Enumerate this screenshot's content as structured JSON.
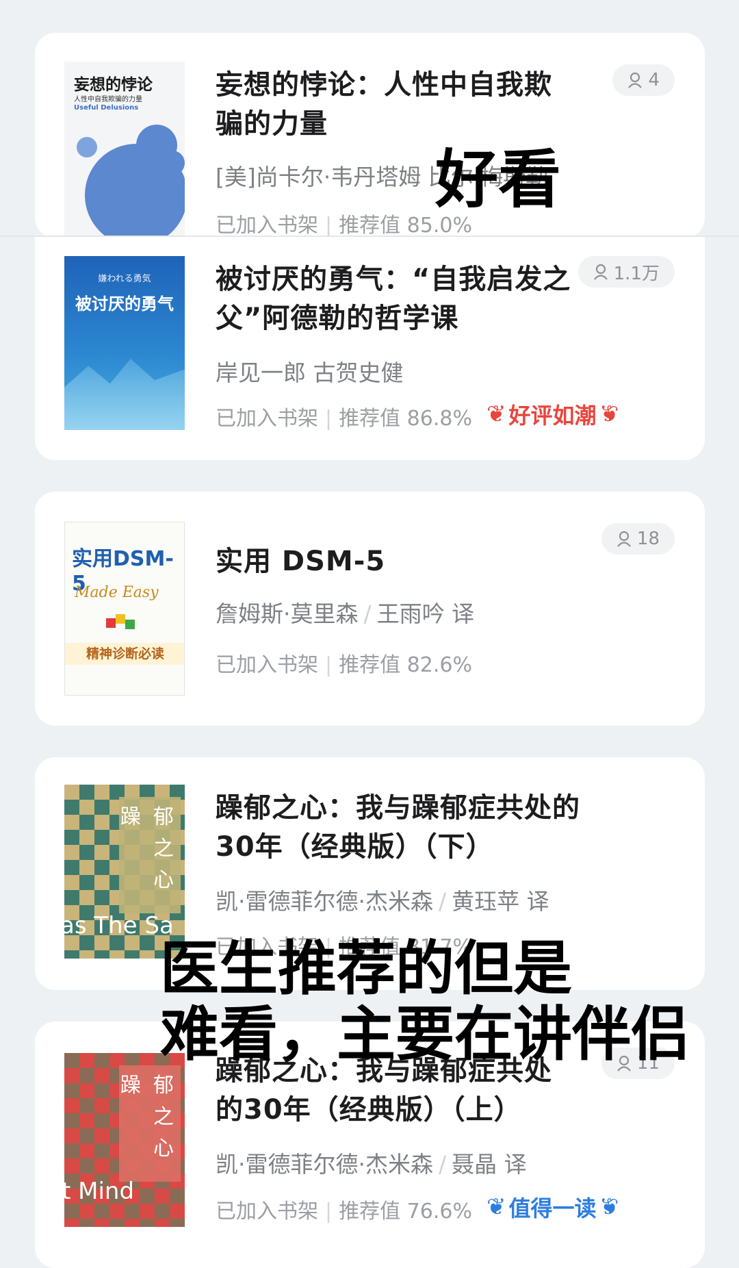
{
  "books": [
    {
      "title": "妄想的悖论：人性中自我欺骗的力量",
      "author": "[美]尚卡尔·韦丹塔姆 比尔·梅斯勒",
      "translator": "",
      "shelf_status": "已加入书架",
      "recommend": "推荐值 85.0%",
      "readers": "4",
      "tag": "",
      "cover_title": "妄想的悖论",
      "cover_subtitle": "人性中自我欺骗的力量",
      "cover_en": "Useful Delusions"
    },
    {
      "title": "被讨厌的勇气：“自我启发之父”阿德勒的哲学课",
      "author": "岸见一郎 古贺史健",
      "translator": "",
      "shelf_status": "已加入书架",
      "recommend": "推荐值 86.8%",
      "readers": "1.1万",
      "tag": "好评如潮",
      "cover_title": "被讨厌的勇气",
      "cover_jp": "嫌われる勇気"
    },
    {
      "title": "实用 DSM-5",
      "author": "詹姆斯·莫里森",
      "translator": "王雨吟 译",
      "shelf_status": "已加入书架",
      "recommend": "推荐值 82.6%",
      "readers": "18",
      "tag": "",
      "cover_title": "实用DSM-5",
      "cover_script": "Made Easy",
      "cover_band": "精神诊断必读"
    },
    {
      "title": "躁郁之心：我与躁郁症共处的30年（经典版）（下）",
      "author": "凯·雷德菲尔德·杰米森",
      "translator": "黄珏苹 译",
      "shelf_status": "已加入书架",
      "recommend": "推荐值 81.7%",
      "readers": "",
      "tag": "",
      "cover_chars": [
        "躁",
        "郁",
        "之",
        "心"
      ],
      "cover_en": "as The Sa"
    },
    {
      "title": "躁郁之心：我与躁郁症共处的30年（经典版）（上）",
      "author": "凯·雷德菲尔德·杰米森",
      "translator": "聂晶 译",
      "shelf_status": "已加入书架",
      "recommend": "推荐值 76.6%",
      "readers": "11",
      "tag": "值得一读",
      "cover_chars": [
        "躁",
        "郁",
        "之",
        "心"
      ],
      "cover_en": "t Mind"
    }
  ],
  "overlays": {
    "good": "好看",
    "line1": "医生推荐的但是",
    "line2": "难看，主要在讲伴侣"
  },
  "colors": {
    "tag_red": "#e8453c",
    "tag_blue": "#2d7de0"
  }
}
